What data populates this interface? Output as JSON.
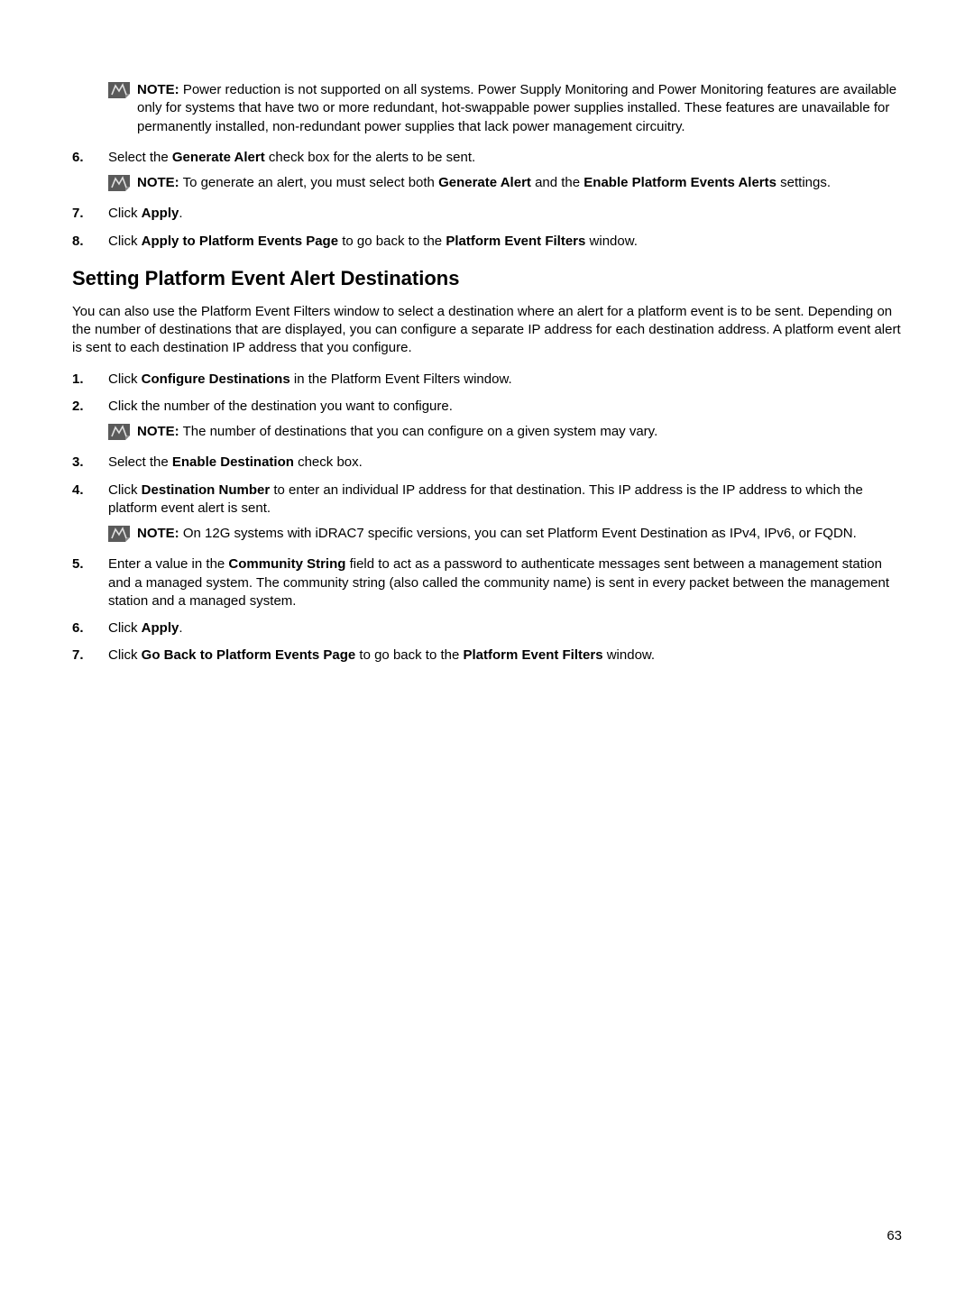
{
  "pre_note": {
    "label": "NOTE:",
    "text": " Power reduction is not supported on all systems. Power Supply Monitoring and Power Monitoring features are available only for systems that have two or more redundant, hot-swappable power supplies installed. These features are unavailable for permanently installed, non-redundant power supplies that lack power management circuitry."
  },
  "steps_top": [
    {
      "num": "6.",
      "parts": [
        "Select the ",
        "Generate Alert",
        " check box for the alerts to be sent."
      ],
      "note": {
        "label": "NOTE:",
        "parts": [
          " To generate an alert, you must select both ",
          "Generate Alert",
          " and the ",
          "Enable Platform Events Alerts",
          " settings."
        ]
      }
    },
    {
      "num": "7.",
      "parts": [
        "Click ",
        "Apply",
        "."
      ]
    },
    {
      "num": "8.",
      "parts": [
        "Click ",
        "Apply to Platform Events Page",
        " to go back to the ",
        "Platform Event Filters",
        " window."
      ]
    }
  ],
  "heading": "Setting Platform Event Alert Destinations",
  "intro": "You can also use the Platform Event Filters window to select a destination where an alert for a platform event is to be sent. Depending on the number of destinations that are displayed, you can configure a separate IP address for each destination address. A platform event alert is sent to each destination IP address that you configure.",
  "steps_bottom": [
    {
      "num": "1.",
      "parts": [
        "Click ",
        "Configure Destinations",
        " in the Platform Event Filters window."
      ]
    },
    {
      "num": "2.",
      "parts": [
        "Click the number of the destination you want to configure."
      ],
      "note": {
        "label": "NOTE:",
        "parts": [
          " The number of destinations that you can configure on a given system may vary."
        ]
      }
    },
    {
      "num": "3.",
      "parts": [
        "Select the ",
        "Enable Destination",
        " check box."
      ]
    },
    {
      "num": "4.",
      "parts": [
        "Click ",
        "Destination Number",
        " to enter an individual IP address for that destination. This IP address is the IP address to which the platform event alert is sent."
      ],
      "note": {
        "label": "NOTE:",
        "parts": [
          " On 12G systems with iDRAC7 specific versions, you can set Platform Event Destination as IPv4, IPv6, or FQDN."
        ]
      }
    },
    {
      "num": "5.",
      "parts": [
        "Enter a value in the ",
        "Community String",
        " field to act as a password to authenticate messages sent between a management station and a managed system. The community string (also called the community name) is sent in every packet between the management station and a managed system."
      ]
    },
    {
      "num": "6.",
      "parts": [
        "Click ",
        "Apply",
        "."
      ]
    },
    {
      "num": "7.",
      "parts": [
        "Click ",
        "Go Back to Platform Events Page",
        " to go back to the ",
        "Platform Event Filters",
        " window."
      ]
    }
  ],
  "page_number": "63"
}
